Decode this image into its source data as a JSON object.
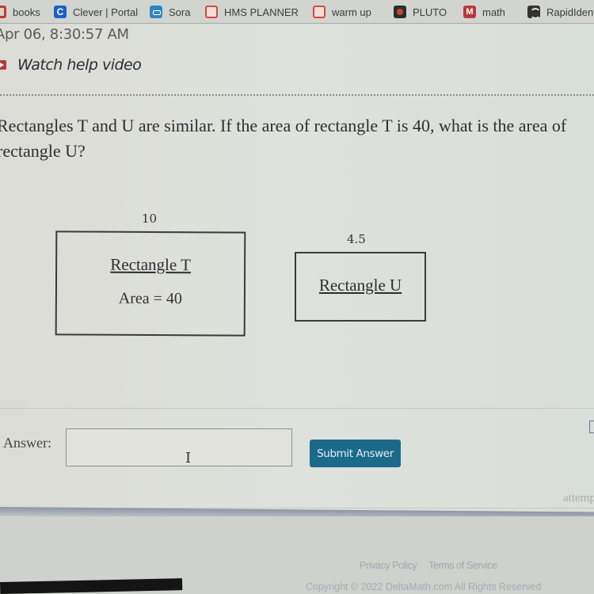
{
  "bookmarks": [
    {
      "label": "books",
      "icon": "books-icon"
    },
    {
      "label": "Clever | Portal",
      "icon": "clever-icon"
    },
    {
      "label": "Sora",
      "icon": "sora-icon"
    },
    {
      "label": "HMS PLANNER",
      "icon": "planner-icon"
    },
    {
      "label": "warm up",
      "icon": "warm-up-icon"
    },
    {
      "label": "PLUTO",
      "icon": "pluto-icon"
    },
    {
      "label": "math",
      "icon": "math-icon"
    },
    {
      "label": "RapidIdentity",
      "icon": "rapididentity-icon"
    }
  ],
  "bookmark_glyphs": {
    "clever": "C",
    "math": "M"
  },
  "header": {
    "timestamp": "Apr 06, 8:30:57 AM",
    "help_video": "Watch help video"
  },
  "question": {
    "line1": "Rectangles T and U are similar. If the area of rectangle T is 40, what is the area of",
    "line2": "rectangle U?"
  },
  "figure": {
    "rect_t": {
      "label": "Rectangle T",
      "side": "10",
      "area_text": "Area = 40"
    },
    "rect_u": {
      "label": "Rectangle U",
      "side": "4.5"
    }
  },
  "answer": {
    "label": "Answer:",
    "value": "",
    "placeholder": "",
    "submit_label": "Submit Answer"
  },
  "attempts_text": "attempts",
  "footer": {
    "privacy": "Privacy Policy",
    "terms": "Terms of Service",
    "copyright": "Copyright © 2022 DeltaMath.com All Rights Reserved"
  },
  "colors": {
    "submit_button": "#1c6a8a",
    "help_icon": "#b93a3a",
    "clever_icon": "#1f5fc8"
  }
}
